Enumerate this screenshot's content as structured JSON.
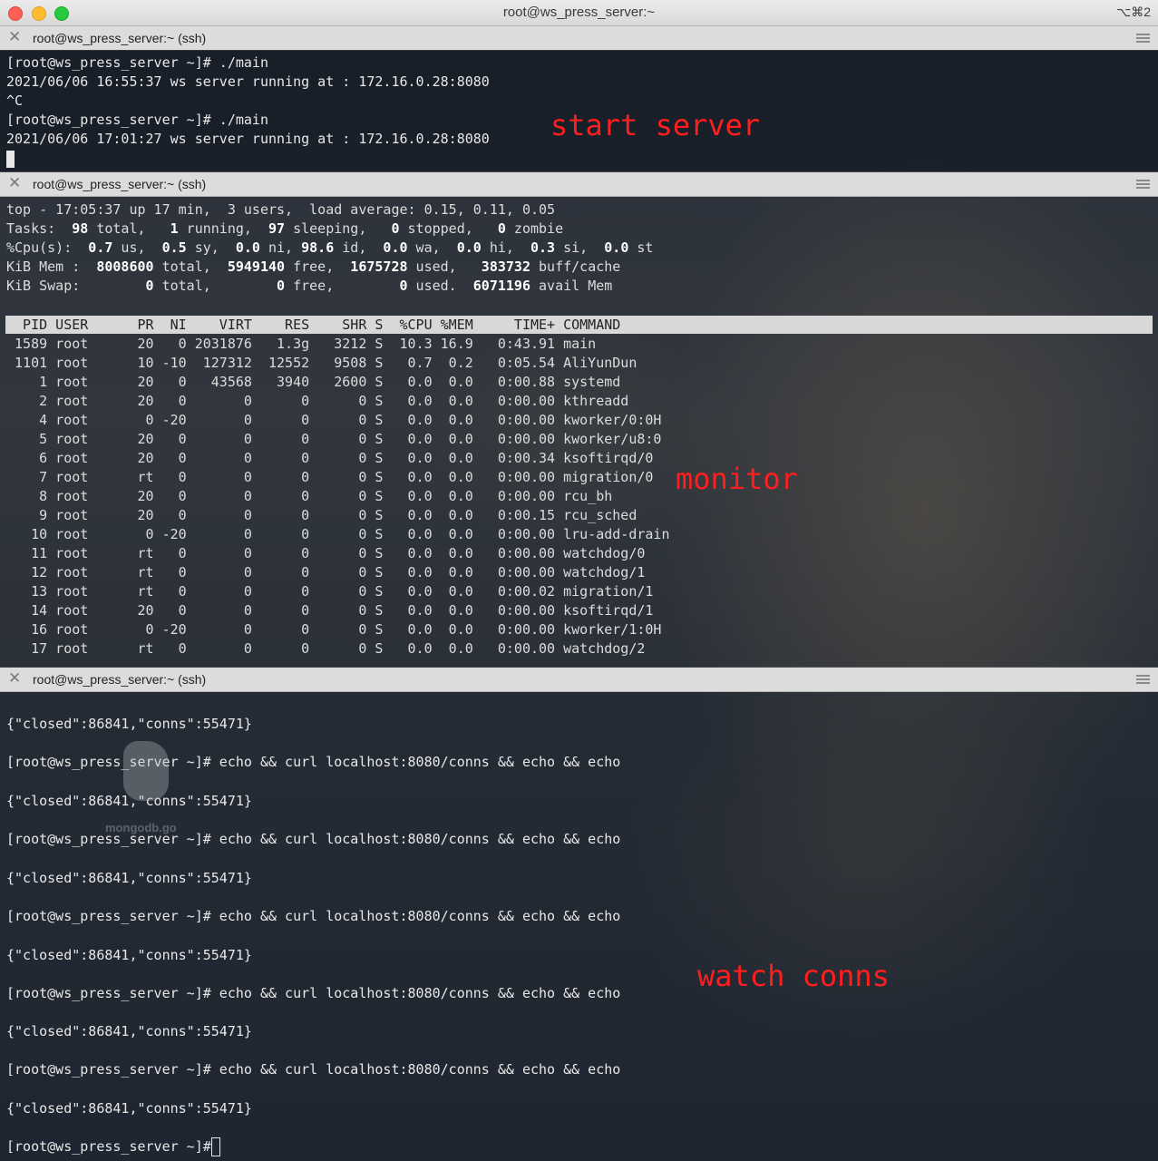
{
  "window": {
    "title": "root@ws_press_server:~",
    "shortcut": "⌥⌘2"
  },
  "panes": [
    {
      "title": "root@ws_press_server:~ (ssh)"
    },
    {
      "title": "root@ws_press_server:~ (ssh)"
    },
    {
      "title": "root@ws_press_server:~ (ssh)"
    }
  ],
  "server_pane": {
    "lines": [
      "[root@ws_press_server ~]# ./main",
      "2021/06/06 16:55:37 ws server running at : 172.16.0.28:8080",
      "^C",
      "[root@ws_press_server ~]# ./main",
      "2021/06/06 17:01:27 ws server running at : 172.16.0.28:8080"
    ],
    "annotation": "start server"
  },
  "top_pane": {
    "summary": {
      "l1": "top - 17:05:37 up 17 min,  3 users,  load average: 0.15, 0.11, 0.05",
      "l2_a": "Tasks: ",
      "l2_v1": " 98",
      "l2_b": " total, ",
      "l2_v2": "  1",
      "l2_c": " running, ",
      "l2_v3": " 97",
      "l2_d": " sleeping, ",
      "l2_v4": "  0",
      "l2_e": " stopped, ",
      "l2_v5": "  0",
      "l2_f": " zombie",
      "l3_a": "%Cpu(s): ",
      "l3_v1": " 0.7",
      "l3_b": " us, ",
      "l3_v2": " 0.5",
      "l3_c": " sy, ",
      "l3_v3": " 0.0",
      "l3_d": " ni, ",
      "l3_v4": "98.6",
      "l3_e": " id, ",
      "l3_v5": " 0.0",
      "l3_f": " wa, ",
      "l3_v6": " 0.0",
      "l3_g": " hi, ",
      "l3_v7": " 0.3",
      "l3_h": " si, ",
      "l3_v8": " 0.0",
      "l3_i": " st",
      "l4_a": "KiB Mem : ",
      "l4_v1": " 8008600",
      "l4_b": " total, ",
      "l4_v2": " 5949140",
      "l4_c": " free, ",
      "l4_v3": " 1675728",
      "l4_d": " used, ",
      "l4_v4": "  383732",
      "l4_e": " buff/cache",
      "l5_a": "KiB Swap: ",
      "l5_v1": "       0",
      "l5_b": " total, ",
      "l5_v2": "       0",
      "l5_c": " free, ",
      "l5_v3": "       0",
      "l5_d": " used. ",
      "l5_v4": " 6071196",
      "l5_e": " avail Mem"
    },
    "header": "  PID USER      PR  NI    VIRT    RES    SHR S  %CPU %MEM     TIME+ COMMAND",
    "rows": [
      " 1589 root      20   0 2031876   1.3g   3212 S  10.3 16.9   0:43.91 main",
      " 1101 root      10 -10  127312  12552   9508 S   0.7  0.2   0:05.54 AliYunDun",
      "    1 root      20   0   43568   3940   2600 S   0.0  0.0   0:00.88 systemd",
      "    2 root      20   0       0      0      0 S   0.0  0.0   0:00.00 kthreadd",
      "    4 root       0 -20       0      0      0 S   0.0  0.0   0:00.00 kworker/0:0H",
      "    5 root      20   0       0      0      0 S   0.0  0.0   0:00.00 kworker/u8:0",
      "    6 root      20   0       0      0      0 S   0.0  0.0   0:00.34 ksoftirqd/0",
      "    7 root      rt   0       0      0      0 S   0.0  0.0   0:00.00 migration/0",
      "    8 root      20   0       0      0      0 S   0.0  0.0   0:00.00 rcu_bh",
      "    9 root      20   0       0      0      0 S   0.0  0.0   0:00.15 rcu_sched",
      "   10 root       0 -20       0      0      0 S   0.0  0.0   0:00.00 lru-add-drain",
      "   11 root      rt   0       0      0      0 S   0.0  0.0   0:00.00 watchdog/0",
      "   12 root      rt   0       0      0      0 S   0.0  0.0   0:00.00 watchdog/1",
      "   13 root      rt   0       0      0      0 S   0.0  0.0   0:00.02 migration/1",
      "   14 root      20   0       0      0      0 S   0.0  0.0   0:00.00 ksoftirqd/1",
      "   16 root       0 -20       0      0      0 S   0.0  0.0   0:00.00 kworker/1:0H",
      "   17 root      rt   0       0      0      0 S   0.0  0.0   0:00.00 watchdog/2"
    ],
    "annotation": "monitor"
  },
  "conns_pane": {
    "lines": [
      "{\"closed\":86841,\"conns\":55471}",
      "[root@ws_press_server ~]# echo && curl localhost:8080/conns && echo && echo",
      "{\"closed\":86841,\"conns\":55471}",
      "[root@ws_press_server ~]# echo && curl localhost:8080/conns && echo && echo",
      "{\"closed\":86841,\"conns\":55471}",
      "[root@ws_press_server ~]# echo && curl localhost:8080/conns && echo && echo",
      "{\"closed\":86841,\"conns\":55471}",
      "[root@ws_press_server ~]# echo && curl localhost:8080/conns && echo && echo",
      "{\"closed\":86841,\"conns\":55471}",
      "[root@ws_press_server ~]# echo && curl localhost:8080/conns && echo && echo",
      "{\"closed\":86841,\"conns\":55471}",
      "[root@ws_press_server ~]# "
    ],
    "annotation": "watch conns",
    "watermark": "mongodb.go"
  },
  "colors": {
    "annotation": "#ff1e1e",
    "close": "#fe5f57",
    "minimize": "#febc2e",
    "zoom": "#28c840"
  }
}
